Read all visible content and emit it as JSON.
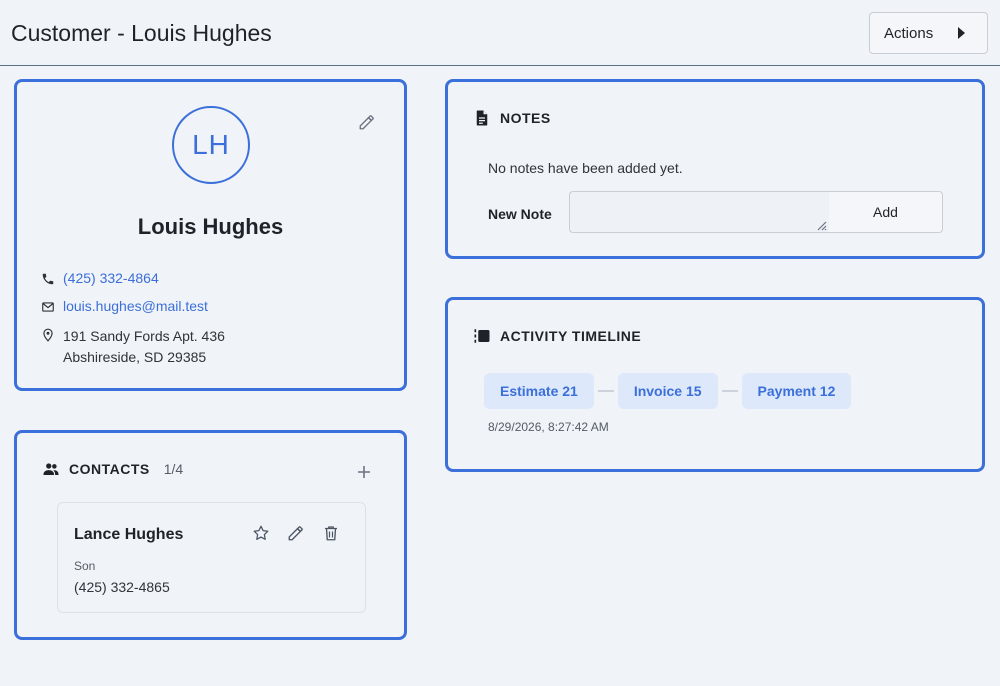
{
  "header": {
    "title": "Customer - Louis Hughes",
    "actions_label": "Actions"
  },
  "profile": {
    "initials": "LH",
    "name": "Louis Hughes",
    "phone": "(425) 332-4864",
    "email": "louis.hughes@mail.test",
    "address_line1": "191 Sandy Fords Apt. 436",
    "address_line2": "Abshireside, SD 29385"
  },
  "contacts": {
    "title": "CONTACTS",
    "count": "1/4",
    "items": [
      {
        "name": "Lance Hughes",
        "relation": "Son",
        "phone": "(425) 332-4865"
      }
    ]
  },
  "notes": {
    "title": "NOTES",
    "empty_text": "No notes have been added yet.",
    "new_note_label": "New Note",
    "input_value": "",
    "add_label": "Add"
  },
  "timeline": {
    "title": "ACTIVITY TIMELINE",
    "items": [
      "Estimate 21",
      "Invoice 15",
      "Payment 12"
    ],
    "timestamp": "8/29/2026, 8:27:42 AM"
  },
  "colors": {
    "accent": "#3b6fd9",
    "chip_bg": "#dde8fb",
    "background": "#f0f3f7"
  },
  "icons": [
    "pencil-icon",
    "phone-icon",
    "mail-icon",
    "location-pin-icon",
    "people-icon",
    "plus-icon",
    "star-icon",
    "trash-icon",
    "document-icon",
    "timeline-icon",
    "caret-right-icon"
  ]
}
